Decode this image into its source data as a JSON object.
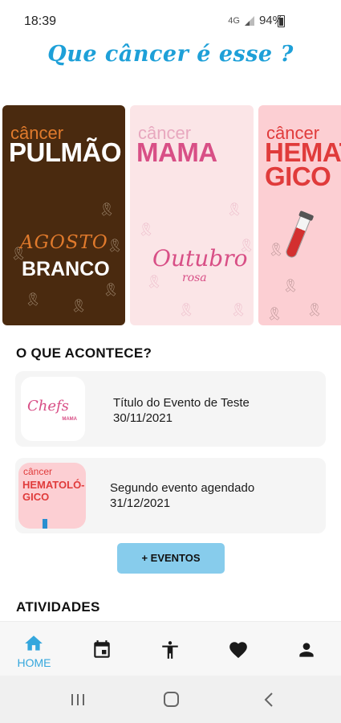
{
  "status_bar": {
    "time": "18:39",
    "network": "4G",
    "battery": "94%"
  },
  "header": {
    "logo_text": "Que câncer é esse ?"
  },
  "banners": [
    {
      "small": "câncer",
      "big": "PULMÃO",
      "sub1": "AGOSTO",
      "sub2": "BRANCO"
    },
    {
      "small": "câncer",
      "big": "MAMA",
      "sub1": "Outubro",
      "sub2": "rosa"
    },
    {
      "small": "câncer",
      "big_line1": "HEMATO",
      "big_line2": "GICO"
    }
  ],
  "events_section": {
    "title": "O QUE ACONTECE?",
    "items": [
      {
        "thumb_text": "Chefs",
        "thumb_sub": "MAMA",
        "title": "Título do Evento de Teste",
        "date": "30/11/2021"
      },
      {
        "thumb_small": "câncer",
        "thumb_big_1": "HEMATOLÓ-",
        "thumb_big_2": "GICO",
        "title": "Segundo evento agendado",
        "date": "31/12/2021"
      }
    ],
    "more_button": "+ EVENTOS"
  },
  "activities_section": {
    "title": "ATIVIDADES"
  },
  "bottom_nav": {
    "items": [
      {
        "icon": "home-icon",
        "label": "HOME",
        "active": true
      },
      {
        "icon": "calendar-icon",
        "label": ""
      },
      {
        "icon": "accessibility-icon",
        "label": ""
      },
      {
        "icon": "heart-icon",
        "label": ""
      },
      {
        "icon": "person-icon",
        "label": ""
      }
    ],
    "active_color": "#35a7dd"
  },
  "colors": {
    "brand_blue": "#1ea0d8",
    "brand_pink": "#e0407a",
    "button_blue": "#87ccec"
  }
}
